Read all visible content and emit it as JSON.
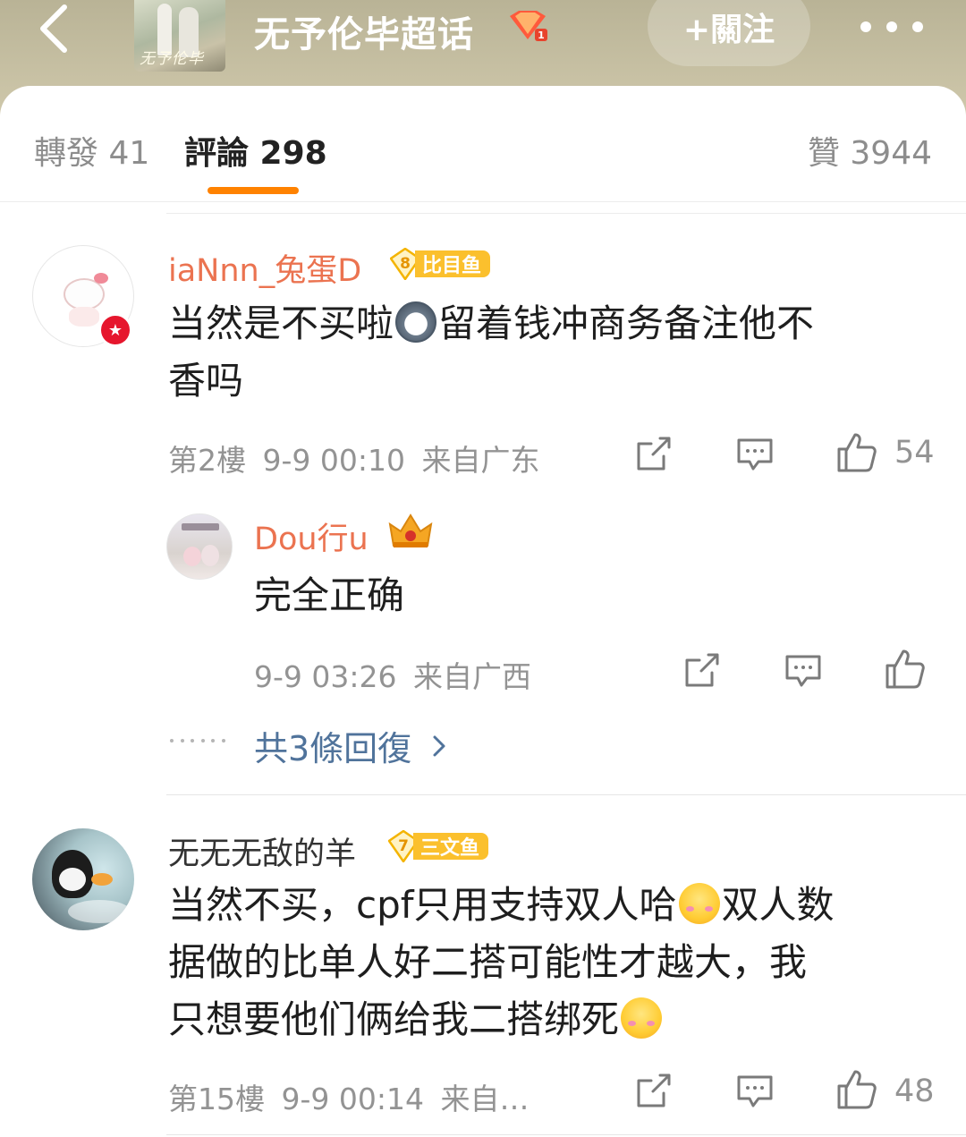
{
  "header": {
    "topic_title": "无予伦毕超话",
    "thumb_text": "无予伦毕",
    "follow_label": "+關注"
  },
  "tabs": [
    {
      "label": "轉發 41"
    },
    {
      "label": "評論 298"
    },
    {
      "label": "贊 3944"
    }
  ],
  "comments": [
    {
      "username": "iaNnn_兔蛋D",
      "level": "8",
      "level_name": "比目鱼",
      "text_line1_a": "当然是不买啦",
      "text_line1_b": "留着钱冲商务备注他不",
      "text_line2": "香吗",
      "floor": "第2樓",
      "time": "9-9 00:10",
      "location": "来自广东",
      "likes": "54",
      "reply": {
        "username": "Dou行u",
        "text": "完全正确",
        "time": "9-9 03:26",
        "location": "来自广西"
      },
      "more_replies": "共3條回復"
    },
    {
      "username": "无无无敌的羊",
      "level": "7",
      "level_name": "三文鱼",
      "text_line1_a": "当然不买，cpf只用支持双人哈",
      "text_line1_b": "双人数",
      "text_line2": "据做的比单人好二搭可能性才越大，我",
      "text_line3": "只想要他们俩给我二搭绑死",
      "floor": "第15樓",
      "time": "9-9 00:14",
      "location": "来自…",
      "likes": "48"
    }
  ],
  "colors": {
    "header_bg": "#c4bd9f",
    "accent_orange": "#ff8200",
    "username_orange": "#eb7350",
    "link_blue": "#50739b",
    "level_gold": "#fbc02d"
  },
  "icons": [
    "back-arrow-icon",
    "vip-gem-icon",
    "more-dots-icon",
    "repost-icon",
    "comment-icon",
    "like-icon",
    "crown-icon",
    "chevron-right-icon",
    "level-diamond-icon"
  ]
}
